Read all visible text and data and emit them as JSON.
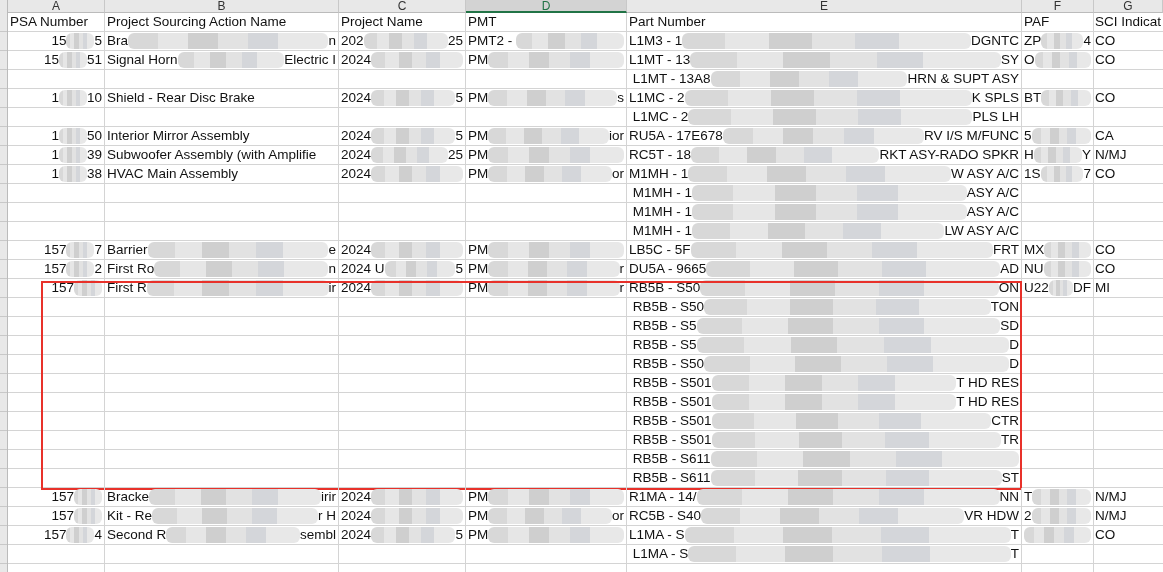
{
  "columns": [
    {
      "letter": "A",
      "selected": false,
      "heading": "PSA Number"
    },
    {
      "letter": "B",
      "selected": false,
      "heading": "Project Sourcing Action Name"
    },
    {
      "letter": "C",
      "selected": false,
      "heading": "Project Name"
    },
    {
      "letter": "D",
      "selected": true,
      "heading": "PMT"
    },
    {
      "letter": "E",
      "selected": false,
      "heading": "Part Number"
    },
    {
      "letter": "F",
      "selected": false,
      "heading": "PAF"
    },
    {
      "letter": "G",
      "selected": false,
      "heading": "SCI Indicat"
    }
  ],
  "rows": [
    {
      "highlighted": false,
      "cells": {
        "A": [
          "15",
          {
            "kind": "blur"
          },
          "5"
        ],
        "B": [
          "Bra",
          {
            "kind": "blur"
          },
          "n"
        ],
        "C": [
          "202",
          {
            "kind": "blur"
          },
          "25"
        ],
        "D": [
          "PMT2 - ",
          {
            "kind": "blur"
          }
        ],
        "E": [
          "L1M3 - 1",
          {
            "kind": "blur"
          },
          "DGNTC"
        ],
        "F": [
          "ZP",
          {
            "kind": "blur"
          },
          "4"
        ],
        "G": [
          "CO"
        ]
      }
    },
    {
      "highlighted": false,
      "cells": {
        "A": [
          "15",
          {
            "kind": "blur"
          },
          "51"
        ],
        "B": [
          "Signal Horn",
          {
            "kind": "blur"
          },
          "Electric I"
        ],
        "C": [
          "2024",
          {
            "kind": "blur"
          }
        ],
        "D": [
          "PM",
          {
            "kind": "blur"
          }
        ],
        "E": [
          "L1MT - 13",
          {
            "kind": "blur"
          },
          "SY"
        ],
        "F": [
          "O",
          {
            "kind": "blur"
          }
        ],
        "G": [
          "CO"
        ]
      }
    },
    {
      "highlighted": false,
      "cells": {
        "E": [
          " L1MT - 13A8",
          {
            "kind": "blur"
          },
          "HRN & SUPT ASY"
        ]
      }
    },
    {
      "highlighted": false,
      "cells": {
        "A": [
          "1",
          {
            "kind": "blur"
          },
          "10"
        ],
        "B": [
          "Shield - Rear Disc Brake"
        ],
        "C": [
          "2024",
          {
            "kind": "blur"
          },
          "5"
        ],
        "D": [
          "PM",
          {
            "kind": "blur"
          },
          "s"
        ],
        "E": [
          "L1MC - 2",
          {
            "kind": "blur"
          },
          "K SPLS"
        ],
        "F": [
          "BT",
          {
            "kind": "blur"
          }
        ],
        "G": [
          "CO"
        ]
      }
    },
    {
      "highlighted": false,
      "cells": {
        "E": [
          " L1MC - 2",
          {
            "kind": "blur"
          },
          "PLS LH"
        ]
      }
    },
    {
      "highlighted": false,
      "cells": {
        "A": [
          "1",
          {
            "kind": "blur"
          },
          "50"
        ],
        "B": [
          "Interior Mirror Assembly"
        ],
        "C": [
          "2024",
          {
            "kind": "blur"
          },
          "5"
        ],
        "D": [
          "PM",
          {
            "kind": "blur"
          },
          "ior"
        ],
        "E": [
          "RU5A - 17E678",
          {
            "kind": "blur"
          },
          "RV I/S M/FUNC"
        ],
        "F": [
          "5",
          {
            "kind": "blur"
          }
        ],
        "G": [
          "CA"
        ]
      }
    },
    {
      "highlighted": false,
      "cells": {
        "A": [
          "1",
          {
            "kind": "blur"
          },
          "39"
        ],
        "B": [
          "Subwoofer Assembly (with Amplifie"
        ],
        "C": [
          "2024",
          {
            "kind": "blur"
          },
          "25"
        ],
        "D": [
          "PM",
          {
            "kind": "blur"
          }
        ],
        "E": [
          "RC5T - 18",
          {
            "kind": "blur"
          },
          "RKT ASY-RADO SPKR"
        ],
        "F": [
          "H",
          {
            "kind": "blur"
          },
          "Y"
        ],
        "G": [
          "N/MJ"
        ]
      }
    },
    {
      "highlighted": false,
      "cells": {
        "A": [
          "1",
          {
            "kind": "blur"
          },
          "38"
        ],
        "B": [
          "HVAC Main Assembly"
        ],
        "C": [
          "2024",
          {
            "kind": "blur"
          }
        ],
        "D": [
          "PM",
          {
            "kind": "blur"
          },
          "or"
        ],
        "E": [
          "M1MH - 1",
          {
            "kind": "blur"
          },
          "W ASY A/C"
        ],
        "F": [
          "1S",
          {
            "kind": "blur"
          },
          "7"
        ],
        "G": [
          "CO"
        ]
      }
    },
    {
      "highlighted": false,
      "cells": {
        "E": [
          " M1MH - 1",
          {
            "kind": "blur"
          },
          "ASY A/C"
        ]
      }
    },
    {
      "highlighted": false,
      "cells": {
        "E": [
          " M1MH - 1",
          {
            "kind": "blur"
          },
          "ASY A/C"
        ]
      }
    },
    {
      "highlighted": false,
      "cells": {
        "E": [
          " M1MH - 1",
          {
            "kind": "blur"
          },
          "LW ASY A/C"
        ]
      }
    },
    {
      "highlighted": false,
      "cells": {
        "A": [
          "157",
          {
            "kind": "blur"
          },
          "7"
        ],
        "B": [
          "Barrier",
          {
            "kind": "blur"
          },
          "e"
        ],
        "C": [
          "2024",
          {
            "kind": "blur"
          }
        ],
        "D": [
          "PM",
          {
            "kind": "blur"
          }
        ],
        "E": [
          "LB5C - 5F",
          {
            "kind": "blur"
          },
          "FRT"
        ],
        "F": [
          "MX",
          {
            "kind": "blur"
          }
        ],
        "G": [
          "CO"
        ]
      }
    },
    {
      "highlighted": false,
      "cells": {
        "A": [
          "157",
          {
            "kind": "blur"
          },
          "2"
        ],
        "B": [
          "First Ro",
          {
            "kind": "blur"
          },
          "n"
        ],
        "C": [
          "2024 U",
          {
            "kind": "blur"
          },
          "5"
        ],
        "D": [
          "PM",
          {
            "kind": "blur"
          },
          "r"
        ],
        "E": [
          "DU5A - 9665",
          {
            "kind": "blur"
          },
          "AD"
        ],
        "F": [
          "NU",
          {
            "kind": "blur"
          }
        ],
        "G": [
          "CO"
        ]
      }
    },
    {
      "highlighted": true,
      "cells": {
        "A": [
          "157",
          {
            "kind": "blur"
          }
        ],
        "B": [
          "First R",
          {
            "kind": "blur"
          },
          "ir"
        ],
        "C": [
          "2024",
          {
            "kind": "blur"
          }
        ],
        "D": [
          "PM",
          {
            "kind": "blur"
          },
          "r"
        ],
        "E": [
          "RB5B - S50",
          {
            "kind": "blur"
          },
          "ON"
        ],
        "F": [
          "U22",
          {
            "kind": "blur"
          },
          "DF"
        ],
        "G": [
          "MI"
        ]
      }
    },
    {
      "highlighted": true,
      "cells": {
        "E": [
          " RB5B - S50",
          {
            "kind": "blur"
          },
          "TON"
        ]
      }
    },
    {
      "highlighted": true,
      "cells": {
        "E": [
          " RB5B - S5",
          {
            "kind": "blur"
          },
          "SD"
        ]
      }
    },
    {
      "highlighted": true,
      "cells": {
        "E": [
          " RB5B - S5",
          {
            "kind": "blur"
          },
          "D"
        ]
      }
    },
    {
      "highlighted": true,
      "cells": {
        "E": [
          " RB5B - S50",
          {
            "kind": "blur"
          },
          "D"
        ]
      }
    },
    {
      "highlighted": true,
      "cells": {
        "E": [
          " RB5B - S501",
          {
            "kind": "blur"
          },
          "T HD RES"
        ]
      }
    },
    {
      "highlighted": true,
      "cells": {
        "E": [
          " RB5B - S501",
          {
            "kind": "blur"
          },
          "T HD RES"
        ]
      }
    },
    {
      "highlighted": true,
      "cells": {
        "E": [
          " RB5B - S501",
          {
            "kind": "blur"
          },
          "CTR"
        ]
      }
    },
    {
      "highlighted": true,
      "cells": {
        "E": [
          " RB5B - S501",
          {
            "kind": "blur"
          },
          "TR"
        ]
      }
    },
    {
      "highlighted": true,
      "cells": {
        "E": [
          " RB5B - S611",
          {
            "kind": "blur"
          }
        ]
      }
    },
    {
      "highlighted": true,
      "cells": {
        "E": [
          " RB5B - S611",
          {
            "kind": "blur"
          },
          "ST"
        ]
      }
    },
    {
      "highlighted": false,
      "cells": {
        "A": [
          "157",
          {
            "kind": "blur"
          }
        ],
        "B": [
          "Bracke",
          {
            "kind": "blur"
          },
          "irir"
        ],
        "C": [
          "2024",
          {
            "kind": "blur"
          }
        ],
        "D": [
          "PM",
          {
            "kind": "blur"
          }
        ],
        "E": [
          "R1MA - 14/",
          {
            "kind": "blur"
          },
          "NN"
        ],
        "F": [
          "T",
          {
            "kind": "blur"
          }
        ],
        "G": [
          "N/MJ"
        ]
      }
    },
    {
      "highlighted": false,
      "cells": {
        "A": [
          "157",
          {
            "kind": "blur"
          }
        ],
        "B": [
          "Kit - Re",
          {
            "kind": "blur"
          },
          "r H"
        ],
        "C": [
          "2024",
          {
            "kind": "blur"
          }
        ],
        "D": [
          "PM",
          {
            "kind": "blur"
          },
          "or"
        ],
        "E": [
          "RC5B - S40",
          {
            "kind": "blur"
          },
          "VR HDW"
        ],
        "F": [
          "2",
          {
            "kind": "blur"
          }
        ],
        "G": [
          "N/MJ"
        ]
      }
    },
    {
      "highlighted": false,
      "cells": {
        "A": [
          "157",
          {
            "kind": "blur"
          },
          "4"
        ],
        "B": [
          "Second R",
          {
            "kind": "blur"
          },
          "sembl"
        ],
        "C": [
          "2024",
          {
            "kind": "blur"
          },
          "5"
        ],
        "D": [
          "PM",
          {
            "kind": "blur"
          }
        ],
        "E": [
          "L1MA - S",
          {
            "kind": "blur"
          },
          "T"
        ],
        "F": [
          {
            "kind": "blur"
          }
        ],
        "G": [
          "CO"
        ]
      }
    },
    {
      "highlighted": false,
      "cells": {
        "E": [
          " L1MA - S",
          {
            "kind": "blur"
          },
          "T"
        ]
      }
    }
  ]
}
